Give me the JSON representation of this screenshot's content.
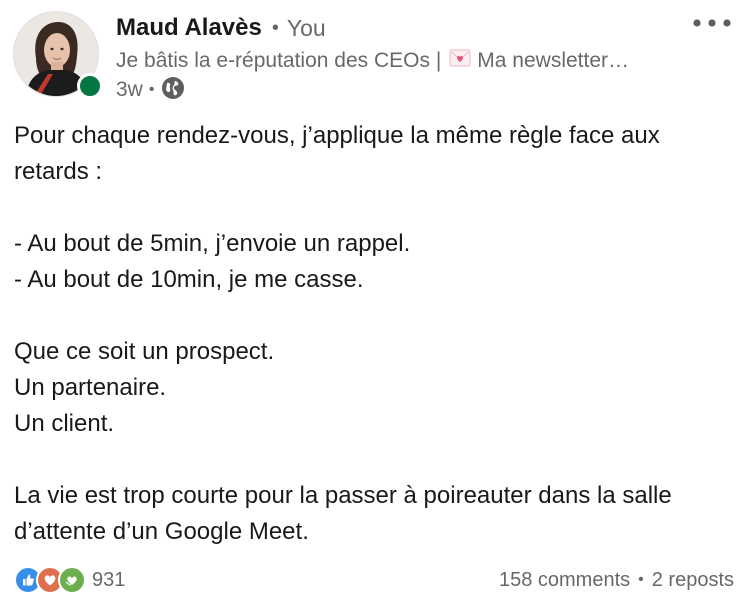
{
  "author": {
    "name": "Maud Alavès",
    "relation": "You",
    "headline_start": "Je bâtis la e-réputation des CEOs |",
    "headline_end": "Ma newsletter…",
    "time": "3w",
    "status": "online",
    "visibility_icon": "globe-icon",
    "avatar_icon": "profile-photo"
  },
  "post": {
    "paragraphs": [
      [
        "Pour chaque rendez-vous, j’applique la même règle face aux",
        "retards :"
      ],
      [
        "- Au bout de 5min, j’envoie un rappel.",
        "- Au bout de 10min, je me casse."
      ],
      [
        "Que ce soit un prospect.",
        "Un partenaire.",
        "Un client."
      ],
      [
        "La vie est trop courte pour la passer à poireauter dans la salle",
        "d’attente d’un Google Meet."
      ]
    ]
  },
  "social": {
    "reaction_icons": [
      "like-icon",
      "love-icon",
      "support-icon"
    ],
    "reaction_count": "931",
    "comments": "158 comments",
    "reposts": "2 reposts"
  },
  "colors": {
    "presence": "#057642",
    "like": "#378fe9",
    "love": "#df704d",
    "support": "#6dae4f",
    "text_secondary": "rgba(0,0,0,0.6)"
  }
}
